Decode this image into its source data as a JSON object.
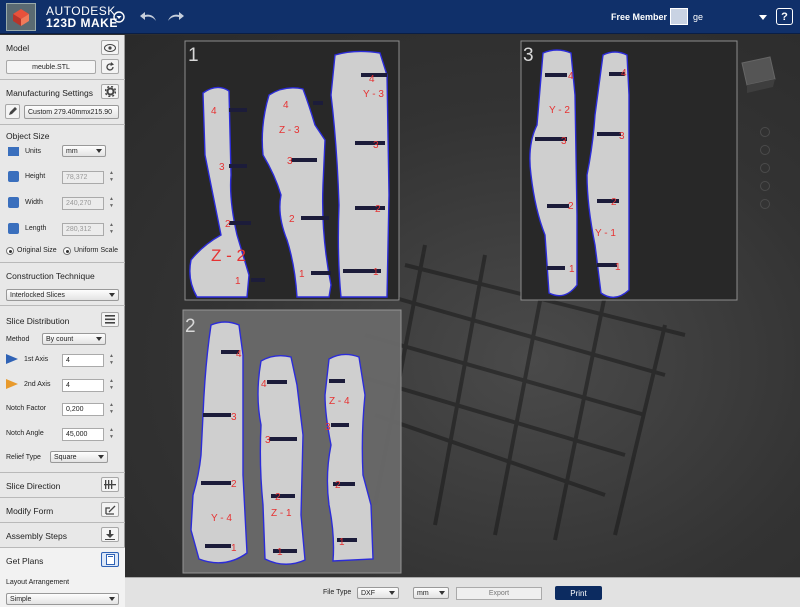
{
  "app": {
    "brand_line1": "AUTODESK",
    "brand_line2": "123D MAKE",
    "brand_sup": "®",
    "member": "Free Member",
    "username": "ge",
    "help": "?"
  },
  "panel": {
    "model": {
      "title": "Model",
      "file": "meuble.STL"
    },
    "manufacturing": {
      "title": "Manufacturing Settings",
      "preset": "Custom 279.40mmx215.90"
    },
    "object_size": {
      "title": "Object Size",
      "units_label": "Units",
      "units_value": "mm",
      "height_label": "Height",
      "height_value": "78,372",
      "width_label": "Width",
      "width_value": "240,270",
      "length_label": "Length",
      "length_value": "280,312",
      "original_size": "Original Size",
      "uniform_scale": "Uniform Scale"
    },
    "construction": {
      "title": "Construction Technique",
      "value": "Interlocked Slices"
    },
    "slice_distribution": {
      "title": "Slice Distribution",
      "method_label": "Method",
      "method_value": "By count",
      "axis1_label": "1st Axis",
      "axis1_value": "4",
      "axis2_label": "2nd Axis",
      "axis2_value": "4",
      "notch_factor_label": "Notch Factor",
      "notch_factor_value": "0,200",
      "notch_angle_label": "Notch Angle",
      "notch_angle_value": "45,000",
      "relief_label": "Relief Type",
      "relief_value": "Square"
    },
    "slice_direction": {
      "title": "Slice Direction"
    },
    "modify_form": {
      "title": "Modify Form"
    },
    "assembly": {
      "title": "Assembly Steps"
    },
    "get_plans": {
      "title": "Get Plans",
      "layout_label": "Layout Arrangement",
      "layout_value": "Simple"
    }
  },
  "bottom": {
    "file_type_label": "File Type",
    "file_type_value": "DXF",
    "unit_value": "mm",
    "export": "Export",
    "print": "Print"
  },
  "sheets": {
    "s1": {
      "num": "1",
      "labels": [
        "4",
        "3",
        "2",
        "Z - 2",
        "1",
        "4",
        "Z - 3",
        "3",
        "2",
        "1",
        "4",
        "Y - 3",
        "3",
        "2",
        "1"
      ]
    },
    "s3": {
      "num": "3",
      "labels": [
        "4",
        "Y - 2",
        "3",
        "2",
        "1",
        "4",
        "3",
        "2",
        "Y - 1",
        "1"
      ]
    },
    "s2": {
      "num": "2",
      "labels": [
        "4",
        "3",
        "2",
        "Y - 4",
        "1",
        "4",
        "3",
        "2",
        "Z - 1",
        "1",
        "Z - 4",
        "3",
        "2",
        "1"
      ]
    }
  },
  "colors": {
    "topbar": "#10306a",
    "outline": "#2c2cd8",
    "label": "#e63232",
    "print": "#0c2b60"
  }
}
